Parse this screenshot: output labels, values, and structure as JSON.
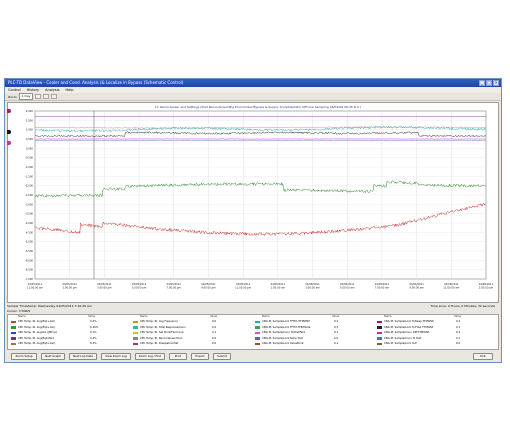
{
  "window": {
    "title": "PLC-TD DataView - Cooler and Cond. Analysis (& Localize in Bypass (Schematic Control)",
    "controls": [
      "_",
      "□",
      "×"
    ]
  },
  "menu": [
    "Control",
    "History",
    "Analysis",
    "Help"
  ],
  "toolbar": {
    "zoom_label": "Zoom",
    "zoom_value": "1 Day"
  },
  "chart": {
    "title": "T-L Recondenser and Settings (Post Recondenser/Big Economizer/Bypass & Supply Sculpt/Isolator Off Line Sampling 06/02/06 06:45 D.C.)",
    "y_ticks": [
      "2,000",
      "1,500",
      "1,000",
      "0,500",
      "0,000",
      "-0,500",
      "-1,000",
      "-1,500",
      "-2,000",
      "-2,500",
      "-3,000",
      "-3,500",
      "-4,000",
      "-4,500",
      "-5,000",
      "-5,500",
      "-6,000",
      "-6,500",
      "-7,000"
    ],
    "x_ticks": [
      {
        "d": "04/05/2011",
        "t": "11:00:00 am"
      },
      {
        "d": "04/05/2011",
        "t": "1:00:00 pm"
      },
      {
        "d": "04/05/2011",
        "t": "3:00:00 pm"
      },
      {
        "d": "04/05/2011",
        "t": "5:00:00 pm"
      },
      {
        "d": "04/05/2011",
        "t": "7:00:00 pm"
      },
      {
        "d": "04/05/2011",
        "t": "9:00:00 pm"
      },
      {
        "d": "04/05/2011",
        "t": "11:00:00 pm"
      },
      {
        "d": "04/06/2011",
        "t": "1:00:00 am"
      },
      {
        "d": "04/06/2011",
        "t": "3:00:00 am"
      },
      {
        "d": "04/06/2011",
        "t": "5:00:00 am"
      },
      {
        "d": "04/06/2011",
        "t": "7:00:00 am"
      },
      {
        "d": "04/06/2011",
        "t": "9:00:00 am"
      },
      {
        "d": "04/06/2011",
        "t": "11:00:00 am"
      },
      {
        "d": "04/06/2011",
        "t": "1:00:00 pm"
      }
    ],
    "markers": [
      {
        "name": "marker-a",
        "color": "#b0186f"
      },
      {
        "name": "marker-b",
        "color": "#151515"
      },
      {
        "name": "marker-c",
        "color": "#d623c6"
      }
    ]
  },
  "status": {
    "sample": "Sample Timestamp: Wednesday 04/05/2011 7:16:26 am",
    "zoom_info": "Time zone: 0 Hours, 0 Minutes, 32 seconds",
    "cursor": "Cursor: 7/306/5"
  },
  "legend": {
    "headers": [
      "Name",
      "Value",
      "Minimum",
      "Maximum"
    ],
    "columns": [
      [
        {
          "color": "#d63b2f",
          "name": "CPU Temp. IR. Avg(Eq1+Cel)",
          "v": "0.2%"
        },
        {
          "color": "#2f9a2f",
          "name": "CPU Temp. IR. Avg(Eq2+Cel)",
          "v": "0.16%"
        },
        {
          "color": "#2b46b7",
          "name": "CPU Temp. IR. AvgGrp (JMP pl)",
          "v": "0.1%"
        },
        {
          "color": "#7d2d86",
          "name": "CPU Temp. IR. Avg(Eq4-Pwr)",
          "v": "0.4%"
        },
        {
          "color": "#9b7a2c",
          "name": "CPU Temp. IR. Avg(Eq5+Cel)",
          "v": "0.3%"
        }
      ],
      [
        {
          "color": "#e08b1f",
          "name": "CPU Temp. RI. Avg Frequency",
          "v": "0.0"
        },
        {
          "color": "#31b7a8",
          "name": "CPU Temp. RI. Total Response/Conn",
          "v": "0.2"
        },
        {
          "color": "#c6c630",
          "name": "CPU Temp. RI. Set Point/Fwd Loop",
          "v": "0.1"
        },
        {
          "color": "#8a8a8a",
          "name": "CPU Temp. RI. Recondenser/Cool",
          "v": "0.0"
        },
        {
          "color": "#b12f6b",
          "name": "CPU Temp. RI. Dissipation/Set",
          "v": "0.0"
        }
      ],
      [
        {
          "color": "#1fa8d1",
          "name": "CNG-M. Sample/Lock TFTM-/TTMWSP",
          "v": "0.2"
        },
        {
          "color": "#3d9b6a",
          "name": "CNG-M. Sample/Lock TFTM-TTB/Mode",
          "v": "0.3"
        },
        {
          "color": "#d15ba8",
          "name": "CNG-M. Sample/Conn Tc/Dist/NLS",
          "v": "0.1"
        },
        {
          "color": "#5c5cd6",
          "name": "CNG-M. Sample/Lock Temp Dist",
          "v": "0.0"
        },
        {
          "color": "#8b5a2b",
          "name": "CNG-M. Sample/Lock ValuePoint",
          "v": "0.1"
        }
      ],
      [
        {
          "color": "#a0195a",
          "name": "CNG-M. Sample/Lock Tc/Keep-TTMWSP",
          "v": "0.4"
        },
        {
          "color": "#222222",
          "name": "CNG-M. Sample/Lock Tc/Flow TTMWSP",
          "v": "0.1"
        },
        {
          "color": "#c628c0",
          "name": "CNG-M. Sample/Conn Diff-TTMWSP",
          "v": "0.2"
        },
        {
          "color": "#3a7bd5",
          "name": "CNG-M. Sample/Conn Tc Dist",
          "v": "0.1"
        },
        {
          "color": "#6a6a2a",
          "name": "CNG-M. Sample/Lock Out",
          "v": "0.0"
        }
      ]
    ]
  },
  "buttons": [
    "Zoom Setup",
    "Next Graph",
    "Next Log Data",
    "View Zoom Log",
    "Zoom Log / Find",
    "Print",
    "Export",
    "Submit",
    "Exit"
  ]
}
